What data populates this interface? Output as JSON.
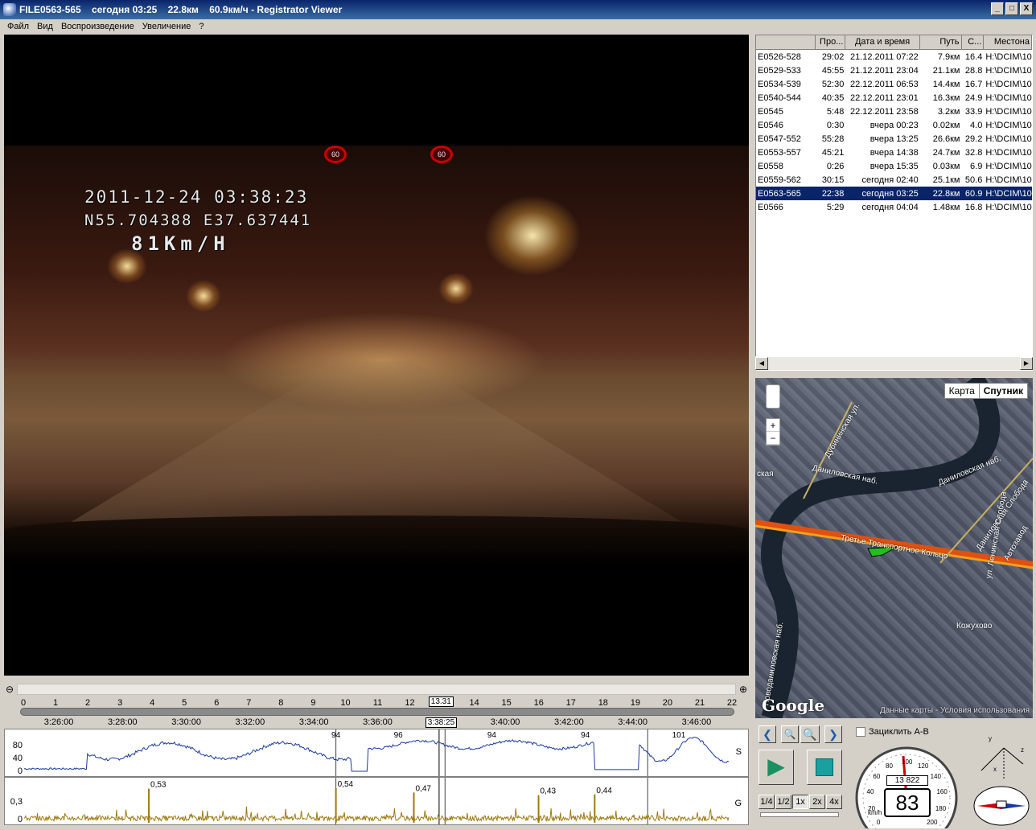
{
  "window": {
    "title": "FILE0563-565    сегодня 03:25    22.8км    60.9км/ч - Registrator Viewer",
    "btn_min": "_",
    "btn_max": "□",
    "btn_close": "X"
  },
  "menu": [
    "Файл",
    "Вид",
    "Воспроизведение",
    "Увеличение",
    "?"
  ],
  "video": {
    "osd_datetime": "2011-12-24  03:38:23",
    "osd_gps": "N55.704388  E37.637441",
    "osd_speed": "81Km/H",
    "sign1": "60",
    "sign2": "60"
  },
  "file_table": {
    "columns": [
      "",
      "Про...",
      "Дата и время",
      "Путь",
      "С...",
      "Местона"
    ],
    "rows": [
      {
        "name": "E0526-528",
        "dur": "29:02",
        "date": "21.12.2011 07:22",
        "path": "7.9км",
        "speed": "16.4",
        "loc": "H:\\DCIM\\10"
      },
      {
        "name": "E0529-533",
        "dur": "45:55",
        "date": "21.12.2011 23:04",
        "path": "21.1км",
        "speed": "28.8",
        "loc": "H:\\DCIM\\10"
      },
      {
        "name": "E0534-539",
        "dur": "52:30",
        "date": "22.12.2011 06:53",
        "path": "14.4км",
        "speed": "16.7",
        "loc": "H:\\DCIM\\10"
      },
      {
        "name": "E0540-544",
        "dur": "40:35",
        "date": "22.12.2011 23:01",
        "path": "16.3км",
        "speed": "24.9",
        "loc": "H:\\DCIM\\10"
      },
      {
        "name": "E0545",
        "dur": "5:48",
        "date": "22.12.2011 23:58",
        "path": "3.2км",
        "speed": "33.9",
        "loc": "H:\\DCIM\\10"
      },
      {
        "name": "E0546",
        "dur": "0:30",
        "date": "вчера 00:23",
        "path": "0.02км",
        "speed": "4.0",
        "loc": "H:\\DCIM\\10"
      },
      {
        "name": "E0547-552",
        "dur": "55:28",
        "date": "вчера 13:25",
        "path": "26.6км",
        "speed": "29.2",
        "loc": "H:\\DCIM\\10"
      },
      {
        "name": "E0553-557",
        "dur": "45:21",
        "date": "вчера 14:38",
        "path": "24.7км",
        "speed": "32.8",
        "loc": "H:\\DCIM\\10"
      },
      {
        "name": "E0558",
        "dur": "0:26",
        "date": "вчера 15:35",
        "path": "0.03км",
        "speed": "6.9",
        "loc": "H:\\DCIM\\10"
      },
      {
        "name": "E0559-562",
        "dur": "30:15",
        "date": "сегодня 02:40",
        "path": "25.1км",
        "speed": "50.6",
        "loc": "H:\\DCIM\\10"
      },
      {
        "name": "E0563-565",
        "dur": "22:38",
        "date": "сегодня 03:25",
        "path": "22.8км",
        "speed": "60.9",
        "loc": "H:\\DCIM\\10",
        "selected": true
      },
      {
        "name": "E0566",
        "dur": "5:29",
        "date": "сегодня 04:04",
        "path": "1.48км",
        "speed": "16.8",
        "loc": "H:\\DCIM\\10"
      }
    ]
  },
  "map": {
    "btn_map": "Карта",
    "btn_satellite": "Спутник",
    "zoom_in": "+",
    "zoom_out": "−",
    "labels": [
      "Дубининская ул.",
      "Даниловская наб.",
      "Даниловская наб.",
      "Даниловская Слобода",
      "Третье Транспортное Кольцо",
      "Кожухово",
      "Новоданиловская наб.",
      "ская",
      "ул. Ленинская Слобода",
      "Автозавод"
    ],
    "logo": "Google",
    "footer": "Данные карты - Условия использования"
  },
  "timeline": {
    "minute_ticks": [
      "0",
      "1",
      "2",
      "3",
      "4",
      "5",
      "6",
      "7",
      "8",
      "9",
      "10",
      "11",
      "12",
      "13",
      "14",
      "15",
      "16",
      "17",
      "18",
      "19",
      "20",
      "21",
      "22"
    ],
    "times": [
      "3:26:00",
      "3:28:00",
      "3:30:00",
      "3:32:00",
      "3:34:00",
      "3:36:00",
      "3:3",
      "3:40:00",
      "3:42:00",
      "3:44:00",
      "3:46:00"
    ],
    "cursor_pos": "13.31",
    "cursor_time": "3:38:25",
    "position_fraction": 0.59
  },
  "speed_graph": {
    "axis": [
      "80",
      "40",
      "0"
    ],
    "side_label": "S",
    "peaks": [
      {
        "label": "94",
        "minute": 10
      },
      {
        "label": "96",
        "minute": 12
      },
      {
        "label": "94",
        "minute": 15
      },
      {
        "label": "94",
        "minute": 18
      },
      {
        "label": "101",
        "minute": 21
      }
    ]
  },
  "g_graph": {
    "axis": [
      "0,3",
      "0"
    ],
    "side_label": "G",
    "peaks": [
      {
        "label": "0,53",
        "minute": 4
      },
      {
        "label": "0,54",
        "minute": 10
      },
      {
        "label": "0,47",
        "minute": 12.5
      },
      {
        "label": "0,43",
        "minute": 16.5
      },
      {
        "label": "0,44",
        "minute": 18.3
      }
    ]
  },
  "controls": {
    "loop_label": "Зациклить A-B",
    "speed_options": [
      "1/4",
      "1/2",
      "1x",
      "2x",
      "4x"
    ],
    "active_speed": "1x",
    "odometer": "13 822",
    "speed": "83",
    "gauge_unit": "km/h",
    "gauge_marks": [
      "0",
      "20",
      "40",
      "60",
      "80",
      "100",
      "120",
      "140",
      "160",
      "180",
      "200"
    ],
    "axes_labels": [
      "y",
      "z",
      "x"
    ]
  },
  "colors": {
    "title_bar": "#0a246a",
    "selection": "#0a246a",
    "speed_line": "#1a3aa0",
    "g_line": "#a07a10"
  }
}
